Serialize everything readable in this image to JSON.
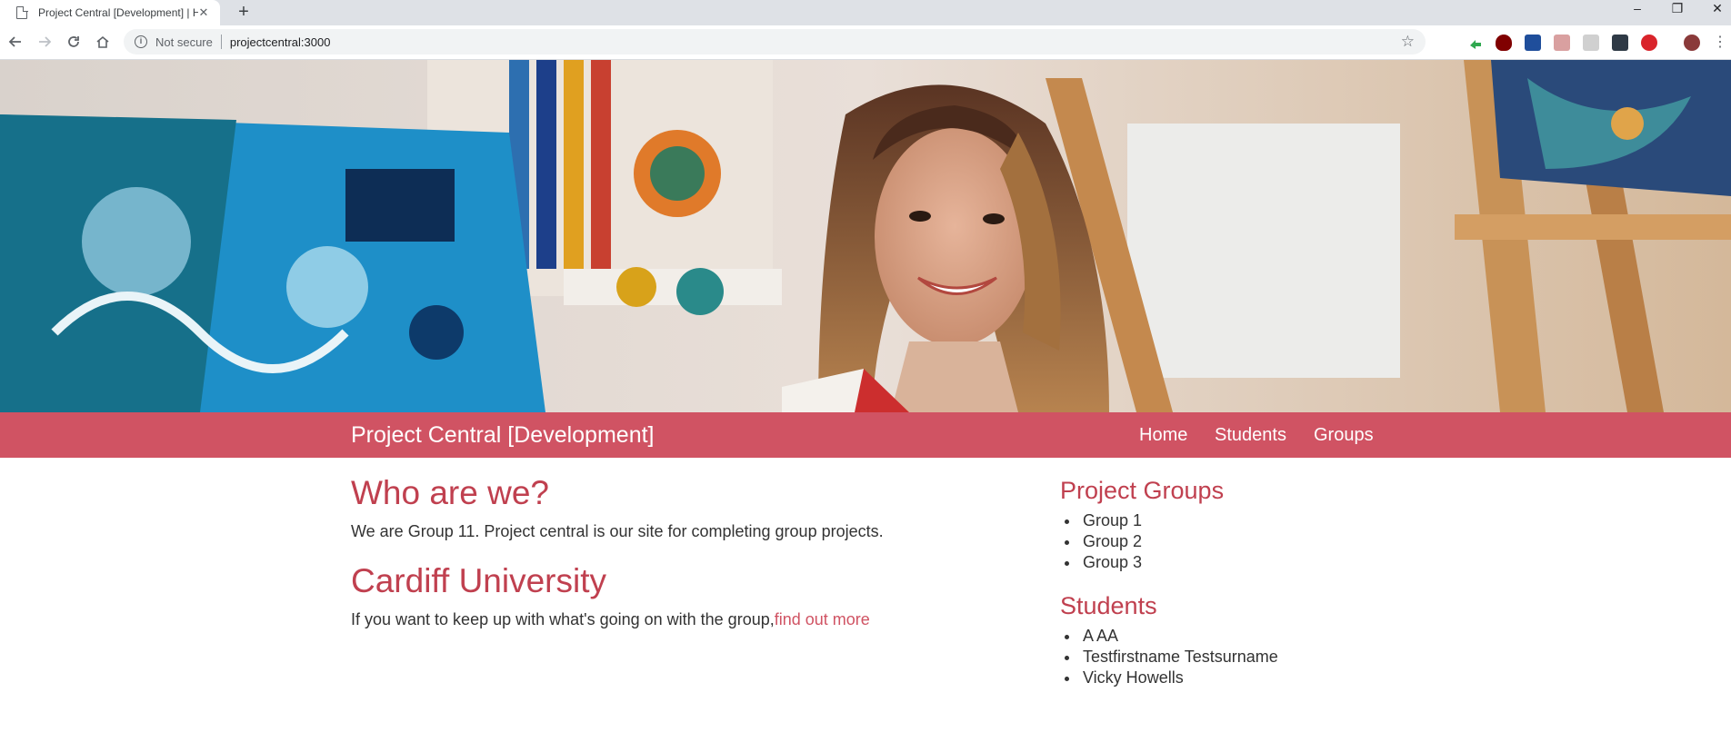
{
  "browser": {
    "tab_title": "Project Central [Development] | H",
    "new_tab_symbol": "+",
    "omnibox": {
      "security_label": "Not secure",
      "url": "projectcentral:3000"
    }
  },
  "hero": {
    "image_icon": "hero-art-studio-photo"
  },
  "navbar": {
    "brand": "Project Central [Development]",
    "links": [
      "Home",
      "Students",
      "Groups"
    ],
    "background_color": "#d05363"
  },
  "main": {
    "about": {
      "heading": "Who are we?",
      "text": "We are Group 11. Project central is our site for completing group projects."
    },
    "university": {
      "heading": "Cardiff University",
      "text": "If you want to keep up with what's going on with the group,",
      "link_text": "find out more"
    }
  },
  "sidebar": {
    "groups": {
      "heading": "Project Groups",
      "items": [
        "Group 1",
        "Group 2",
        "Group 3"
      ]
    },
    "students": {
      "heading": "Students",
      "items": [
        "A AA",
        "Testfirstname Testsurname",
        "Vicky Howells"
      ]
    }
  },
  "colors": {
    "accent": "#d05363",
    "heading": "#c0404f",
    "text": "#333333"
  }
}
